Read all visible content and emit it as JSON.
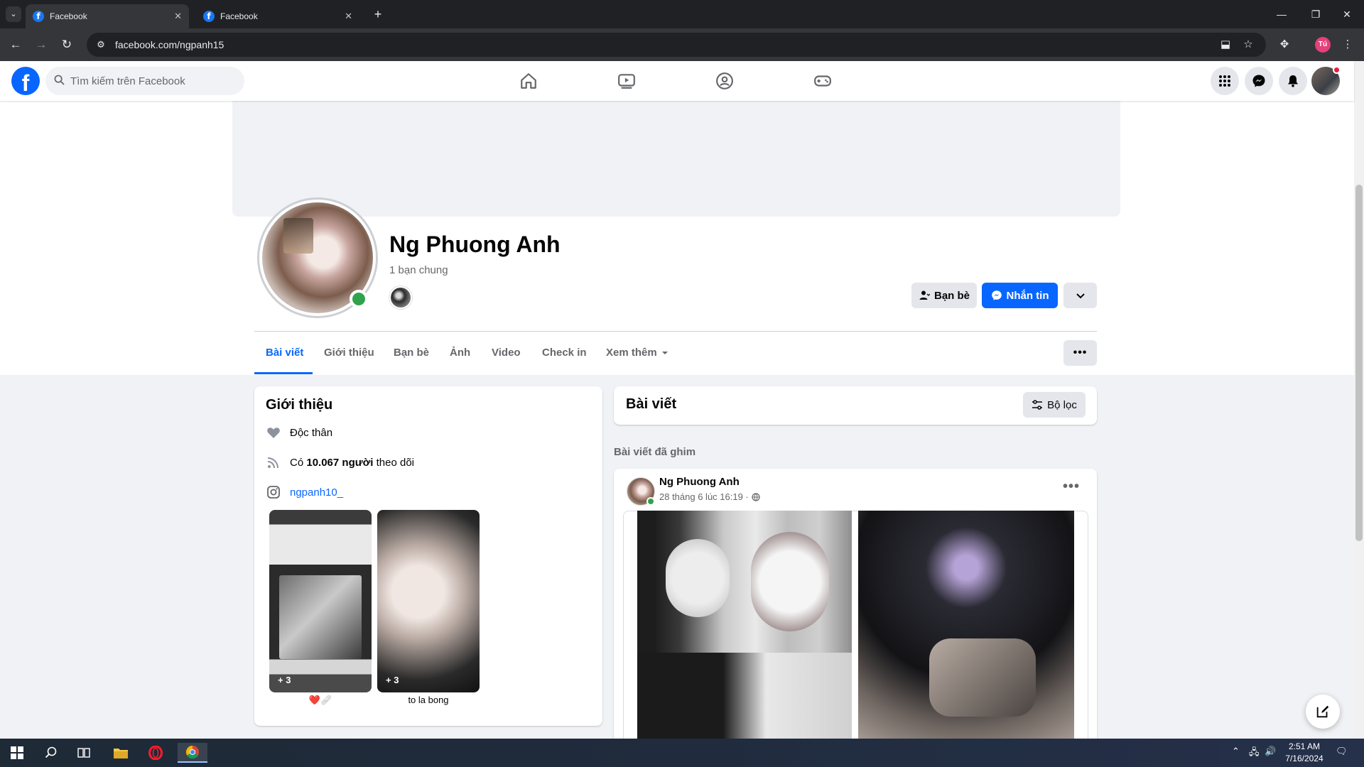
{
  "browser": {
    "tabs": [
      {
        "title": "Facebook",
        "active": true
      },
      {
        "title": "Facebook",
        "active": false
      }
    ],
    "url": "facebook.com/ngpanh15",
    "profile_initial": "Tú"
  },
  "header": {
    "search_placeholder": "Tìm kiếm trên Facebook"
  },
  "profile": {
    "name": "Ng Phuong Anh",
    "mutual_friends": "1 bạn chung",
    "friends_button": "Bạn bè",
    "message_button": "Nhắn tin",
    "tabs": [
      "Bài viết",
      "Giới thiệu",
      "Bạn bè",
      "Ảnh",
      "Video",
      "Check in",
      "Xem thêm"
    ]
  },
  "intro": {
    "title": "Giới thiệu",
    "relationship": "Độc thân",
    "followers_prefix": "Có",
    "followers_count": "10.067 người",
    "followers_suffix": "theo dõi",
    "instagram": "ngpanh10_",
    "stories": [
      {
        "count": "+ 3",
        "caption": "❤️🩹"
      },
      {
        "count": "+ 3",
        "caption": "to la bong"
      }
    ]
  },
  "posts": {
    "title": "Bài viết",
    "filter_button": "Bộ lọc",
    "pinned_label": "Bài viết đã ghim",
    "post": {
      "author": "Ng Phuong Anh",
      "time": "28 tháng 6 lúc 16:19 ·"
    }
  },
  "taskbar": {
    "time": "2:51 AM",
    "date": "7/16/2024"
  },
  "colors": {
    "fb_blue": "#0866ff",
    "online_green": "#31a24c",
    "page_bg": "#f0f2f5"
  }
}
